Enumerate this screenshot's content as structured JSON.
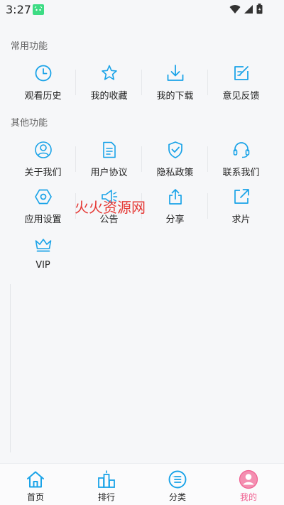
{
  "status_bar": {
    "time": "3:27"
  },
  "sections": {
    "common_title": "常用功能",
    "other_title": "其他功能"
  },
  "common_items": [
    {
      "label": "观看历史",
      "icon": "clock-icon"
    },
    {
      "label": "我的收藏",
      "icon": "star-icon"
    },
    {
      "label": "我的下载",
      "icon": "download-icon"
    },
    {
      "label": "意见反馈",
      "icon": "edit-icon"
    }
  ],
  "other_items": [
    {
      "label": "关于我们",
      "icon": "user-icon"
    },
    {
      "label": "用户协议",
      "icon": "document-icon"
    },
    {
      "label": "隐私政策",
      "icon": "shield-check-icon"
    },
    {
      "label": "联系我们",
      "icon": "headset-icon"
    },
    {
      "label": "应用设置",
      "icon": "hexagon-settings-icon"
    },
    {
      "label": "公告",
      "icon": "speaker-icon"
    },
    {
      "label": "分享",
      "icon": "share-icon"
    },
    {
      "label": "求片",
      "icon": "external-link-icon"
    },
    {
      "label": "VIP",
      "icon": "crown-icon"
    }
  ],
  "watermark": "火火资源网",
  "bottom_nav": [
    {
      "label": "首页",
      "icon": "home-icon"
    },
    {
      "label": "排行",
      "icon": "ranking-icon"
    },
    {
      "label": "分类",
      "icon": "category-icon"
    },
    {
      "label": "我的",
      "icon": "profile-icon",
      "active": true
    }
  ],
  "colors": {
    "accent": "#1aa3e8",
    "active": "#f06292",
    "background": "#f6f7f9"
  }
}
